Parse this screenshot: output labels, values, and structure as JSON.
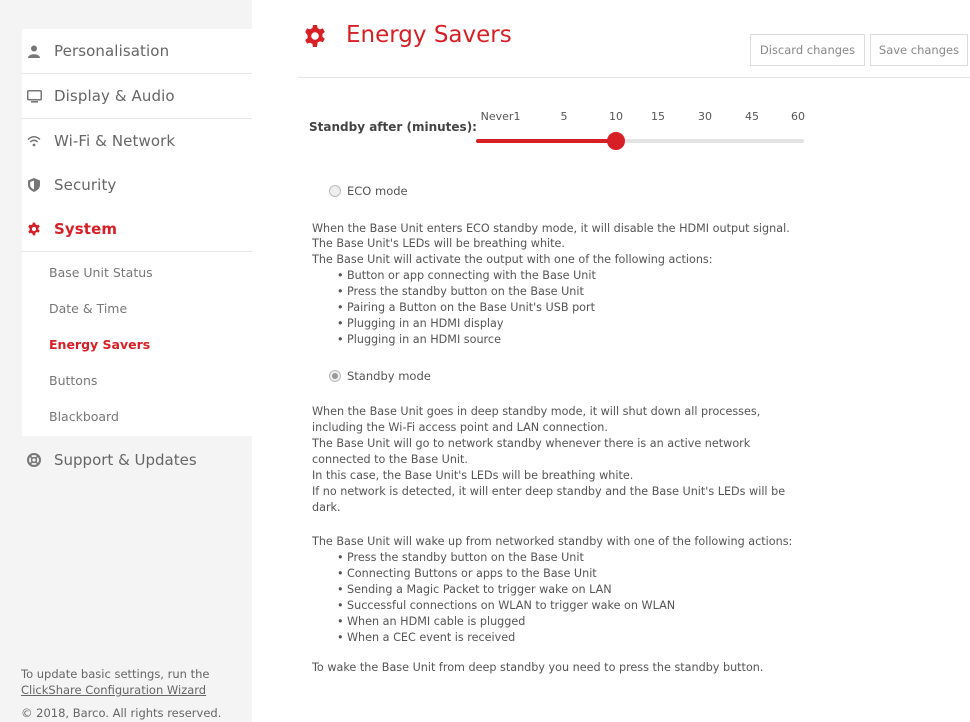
{
  "sidebar": {
    "items": [
      {
        "label": "Personalisation",
        "icon": "person-icon"
      },
      {
        "label": "Display & Audio",
        "icon": "monitor-icon"
      },
      {
        "label": "Wi-Fi & Network",
        "icon": "wifi-icon"
      },
      {
        "label": "Security",
        "icon": "shield-icon"
      },
      {
        "label": "System",
        "icon": "gear-icon"
      }
    ],
    "sub_items": [
      "Base Unit Status",
      "Date & Time",
      "Energy Savers",
      "Buttons",
      "Blackboard"
    ],
    "support": {
      "label": "Support & Updates",
      "icon": "lifebuoy-icon"
    },
    "footer": {
      "line1": "To update basic settings, run the",
      "link": "ClickShare Configuration Wizard",
      "copyright": "© 2018, Barco. All rights reserved."
    }
  },
  "header": {
    "title": "Energy Savers",
    "discard_label": "Discard changes",
    "save_label": "Save changes"
  },
  "standby": {
    "label": "Standby after (minutes):",
    "ticks": [
      "Never",
      "1",
      "5",
      "10",
      "15",
      "30",
      "45",
      "60"
    ],
    "selected": "10"
  },
  "eco": {
    "label": "ECO mode",
    "checked": false,
    "lines": [
      "When the Base Unit enters ECO standby mode, it will disable the HDMI output signal.",
      "The Base Unit's LEDs will be breathing white.",
      "The Base Unit will activate the output with one of the following actions:"
    ],
    "bullets": [
      "Button or app connecting with the Base Unit",
      "Press the standby button on the Base Unit",
      "Pairing a Button on the Base Unit's USB port",
      "Plugging in an HDMI display",
      "Plugging in an HDMI source"
    ]
  },
  "standby_mode": {
    "label": "Standby mode",
    "checked": true,
    "lines": [
      "When the Base Unit goes in deep standby mode, it will shut down all processes,",
      "including the Wi-Fi access point and LAN connection.",
      "The Base Unit will go to network standby whenever there is an active network",
      "connected to the Base Unit.",
      "In this case, the Base Unit's LEDs will be breathing white.",
      "If no network is detected, it will enter deep standby and the Base Unit's LEDs will be",
      "dark."
    ],
    "wake_intro": "The Base Unit will wake up from networked standby with one of the following actions:",
    "bullets": [
      "Press the standby button on the Base Unit",
      "Connecting Buttons or apps to the Base Unit",
      "Sending a Magic Packet to trigger wake on LAN",
      "Successful connections on WLAN to trigger wake on WLAN",
      "When an HDMI cable is plugged",
      "When a CEC event is received"
    ],
    "footer_note": "To wake the Base Unit from deep standby you need to press the standby button."
  },
  "colors": {
    "accent": "#d71f26",
    "text": "#555555",
    "sidebar_bg": "#f4f4f4"
  }
}
